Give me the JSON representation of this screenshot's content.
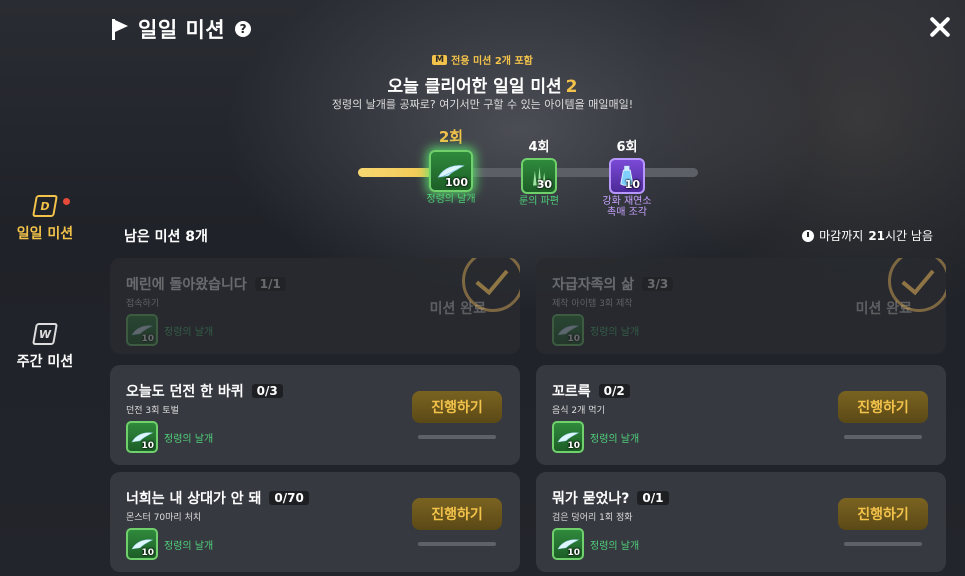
{
  "header": {
    "title": "일일 미션",
    "help": "?"
  },
  "sidebar": {
    "tabs": [
      {
        "label": "일일 미션",
        "icon_letter": "D",
        "active": true
      },
      {
        "label": "주간 미션",
        "icon_letter": "W",
        "active": false
      }
    ]
  },
  "banner": {
    "badge_letter": "M",
    "badge_text": "전용 미션 2개 포함",
    "headline": "오늘 클리어한 일일 미션",
    "headline_count": "2",
    "subline": "정령의 날개를 공짜로? 여기서만 구할 수 있는 아이템을 매일매일!"
  },
  "progress": {
    "fraction": 0.33,
    "rewards": [
      {
        "count": "2회",
        "qty": "100",
        "name": "정령의 날개",
        "kind": "wing"
      },
      {
        "count": "4회",
        "qty": "30",
        "name": "룬의 파편",
        "kind": "rune"
      },
      {
        "count": "6회",
        "qty": "10",
        "name": "강화 재연소\n촉매 조각",
        "kind": "potion"
      }
    ]
  },
  "remaining": "남은 미션 8개",
  "deadline": {
    "prefix": "마감까지",
    "value": "21",
    "suffix": "시간 남음"
  },
  "missions": [
    {
      "title": "메린에 돌아왔습니다",
      "progress": "1/1",
      "desc": "접속하기",
      "reward_name": "정령의 날개",
      "reward_qty": "10",
      "status": "미션 완료",
      "done": true
    },
    {
      "title": "자급자족의 삶",
      "progress": "3/3",
      "desc": "제작 아이템 3회 제작",
      "reward_name": "정령의 날개",
      "reward_qty": "10",
      "status": "미션 완료",
      "done": true
    },
    {
      "title": "오늘도 던전 한 바퀴",
      "progress": "0/3",
      "desc": "던전 3회 토벌",
      "reward_name": "정령의 날개",
      "reward_qty": "10",
      "button": "진행하기",
      "done": false
    },
    {
      "title": "꼬르륵",
      "progress": "0/2",
      "desc": "음식 2개 먹기",
      "reward_name": "정령의 날개",
      "reward_qty": "10",
      "button": "진행하기",
      "done": false
    },
    {
      "title": "너희는 내 상대가 안 돼",
      "progress": "0/70",
      "desc": "몬스터 70마리 처치",
      "reward_name": "정령의 날개",
      "reward_qty": "10",
      "button": "진행하기",
      "done": false
    },
    {
      "title": "뭐가 묻었나?",
      "progress": "0/1",
      "desc": "검은 덩어리 1회 정화",
      "reward_name": "정령의 날개",
      "reward_qty": "10",
      "button": "진행하기",
      "done": false
    }
  ],
  "colors": {
    "accent": "#f2c24a",
    "reward_green": "#4fd07a",
    "alert": "#e84a3a"
  }
}
